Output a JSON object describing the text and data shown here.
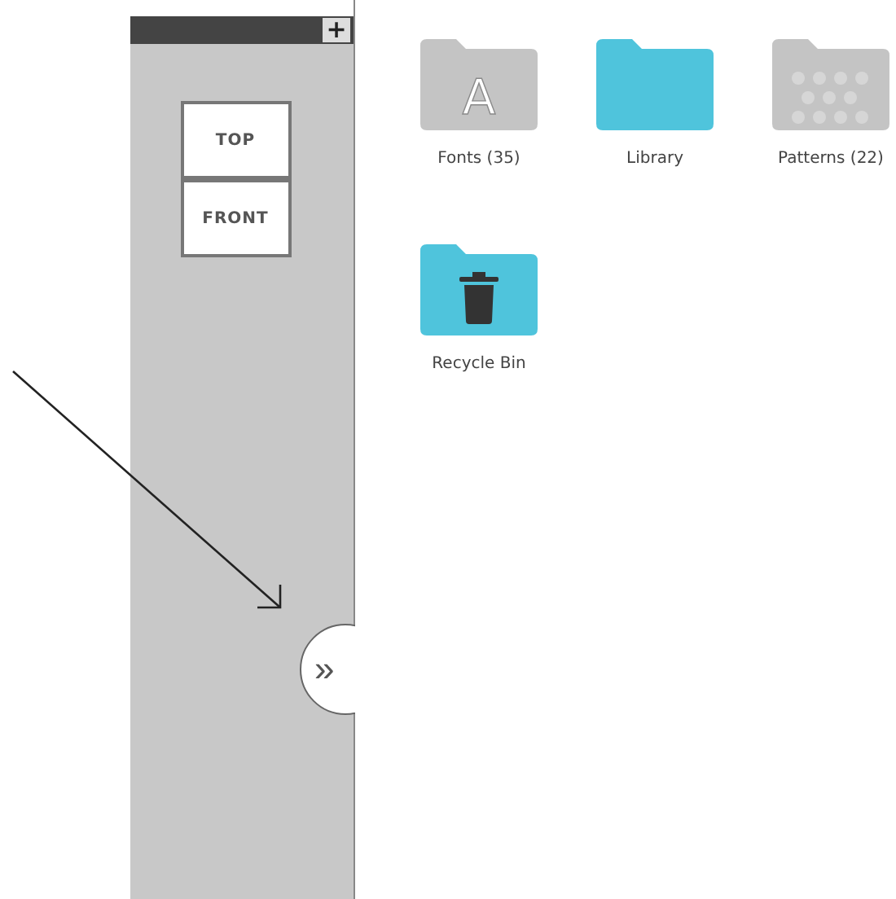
{
  "sidebar": {
    "add_button": "+",
    "view_cube": {
      "top": "TOP",
      "front": "FRONT"
    },
    "expand_button": "»"
  },
  "folders": [
    {
      "label": "Fonts (35)",
      "kind": "letter",
      "glyph": "A",
      "color": "#c4c4c4"
    },
    {
      "label": "Library",
      "kind": "plain",
      "color": "#4fc4dc"
    },
    {
      "label": "Patterns (22)",
      "kind": "dots",
      "color": "#c4c4c4"
    },
    {
      "label": "Recycle Bin",
      "kind": "trash",
      "color": "#4fc4dc"
    }
  ]
}
